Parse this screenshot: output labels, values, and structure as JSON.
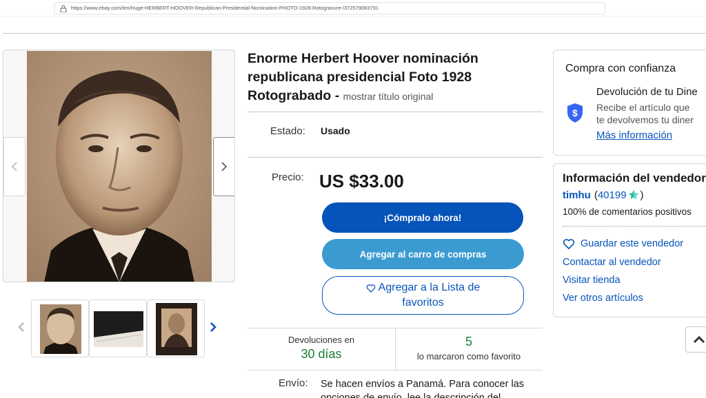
{
  "browser": {
    "url": "https://www.ebay.com/itm/Huge-HERBERT-HOOVER-Republican-Presidential-Nomination-PHOTO-1928-Rotogravure-/372579083791"
  },
  "listing": {
    "title": "Enorme Herbert Hoover nominación republicana presidencial Foto 1928 Rotograbado -",
    "show_original": "mostrar título original",
    "condition_label": "Estado:",
    "condition_value": "Usado",
    "price_label": "Precio:",
    "price_value": "US $33.00",
    "buy_now": "¡Cómpralo ahora!",
    "add_to_cart": "Agregar al carro de compras",
    "add_to_watchlist_line1": "Agregar a la Lista de",
    "add_to_watchlist_line2": "favoritos",
    "returns_title": "Devoluciones en",
    "returns_value": "30 días",
    "watch_count": "5",
    "watch_label": "lo marcaron como favorito",
    "shipping_label": "Envío:",
    "shipping_text": "Se hacen envíos a Panamá. Para conocer las opciones de envío, lee la descripción del"
  },
  "trust_panel": {
    "title": "Compra con confianza",
    "heading": "Devolución de tu Dine",
    "desc_line1": "Recibe el artículo que",
    "desc_line2": "te devolvemos tu diner",
    "link": "Más información"
  },
  "seller_panel": {
    "title": "Información del vendedor",
    "seller_name": "timhu",
    "open_paren": "(",
    "feedback_score": "40199",
    "close_paren": ")",
    "positive": "100% de comentarios positivos",
    "save_seller": "Guardar este vendedor",
    "contact": "Contactar al vendedor",
    "visit_store": "Visitar tienda",
    "other_items": "Ver otros artículos"
  },
  "colors": {
    "primary_blue": "#0654ba",
    "light_blue": "#3b9bd1",
    "green": "#1e7e34"
  },
  "icons": {
    "lock": "lock-icon",
    "shield": "shield-dollar-icon",
    "star": "star-icon",
    "heart": "heart-icon",
    "chevron_left": "chevron-left-icon",
    "chevron_right": "chevron-right-icon",
    "chevron_up": "chevron-up-icon"
  }
}
